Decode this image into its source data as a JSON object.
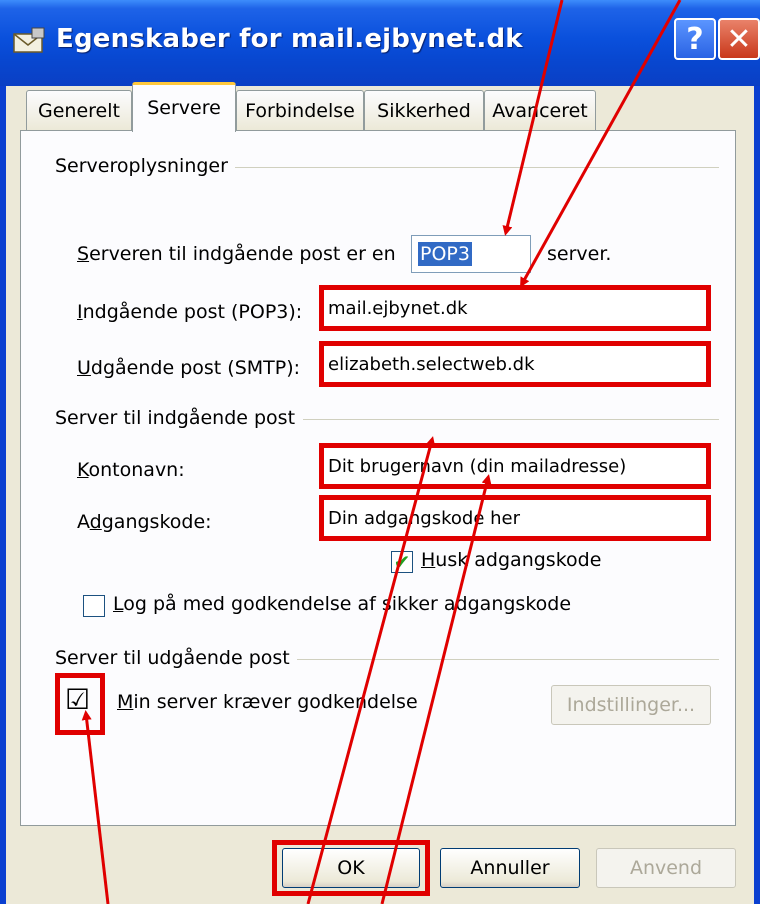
{
  "window": {
    "title": "Egenskaber for mail.ejbynet.dk",
    "help_label": "?",
    "close_label": "✕"
  },
  "tabs": [
    {
      "label": "Generelt",
      "active": false
    },
    {
      "label": "Servere",
      "active": true
    },
    {
      "label": "Forbindelse",
      "active": false
    },
    {
      "label": "Sikkerhed",
      "active": false
    },
    {
      "label": "Avanceret",
      "active": false
    }
  ],
  "server_info": {
    "group_label": "Serveroplysninger",
    "incoming_type_label_prefix": "S",
    "incoming_type_label_rest": "erveren til indgående post er en",
    "incoming_type_value": "POP3",
    "incoming_type_suffix": "server.",
    "incoming_label_prefix": "I",
    "incoming_label_rest": "ndgående post (POP3):",
    "incoming_value": "mail.ejbynet.dk",
    "outgoing_label_prefix": "U",
    "outgoing_label_rest": "dgående post (SMTP):",
    "outgoing_value": "elizabeth.selectweb.dk"
  },
  "incoming_server": {
    "group_label": "Server til indgående post",
    "account_label_prefix": "K",
    "account_label_rest": "ontonavn:",
    "account_value": "Dit brugernavn (din mailadresse)",
    "password_label_a": "A",
    "password_label_b": "d",
    "password_label_rest": "gangskode:",
    "password_value": "Din adgangskode her",
    "remember_label_prefix": "H",
    "remember_label_rest": "usk adgangskode",
    "remember_checked": true,
    "secure_label_prefix": "L",
    "secure_label_rest": "og på med godkendelse af sikker adgangskode",
    "secure_checked": false
  },
  "outgoing_server": {
    "group_label": "Server til udgående post",
    "auth_label_prefix": "M",
    "auth_label_rest": "in server kræver godkendelse",
    "auth_checked": true,
    "auth_mark": "☑",
    "settings_label": "Indstillinger..."
  },
  "footer": {
    "ok_label": "OK",
    "cancel_label": "Annuller",
    "apply_label": "Anvend"
  },
  "colors": {
    "annotation_red": "#e00000",
    "title_bar_blue": "#0a50dc",
    "dialog_bg": "#ece9d8"
  }
}
